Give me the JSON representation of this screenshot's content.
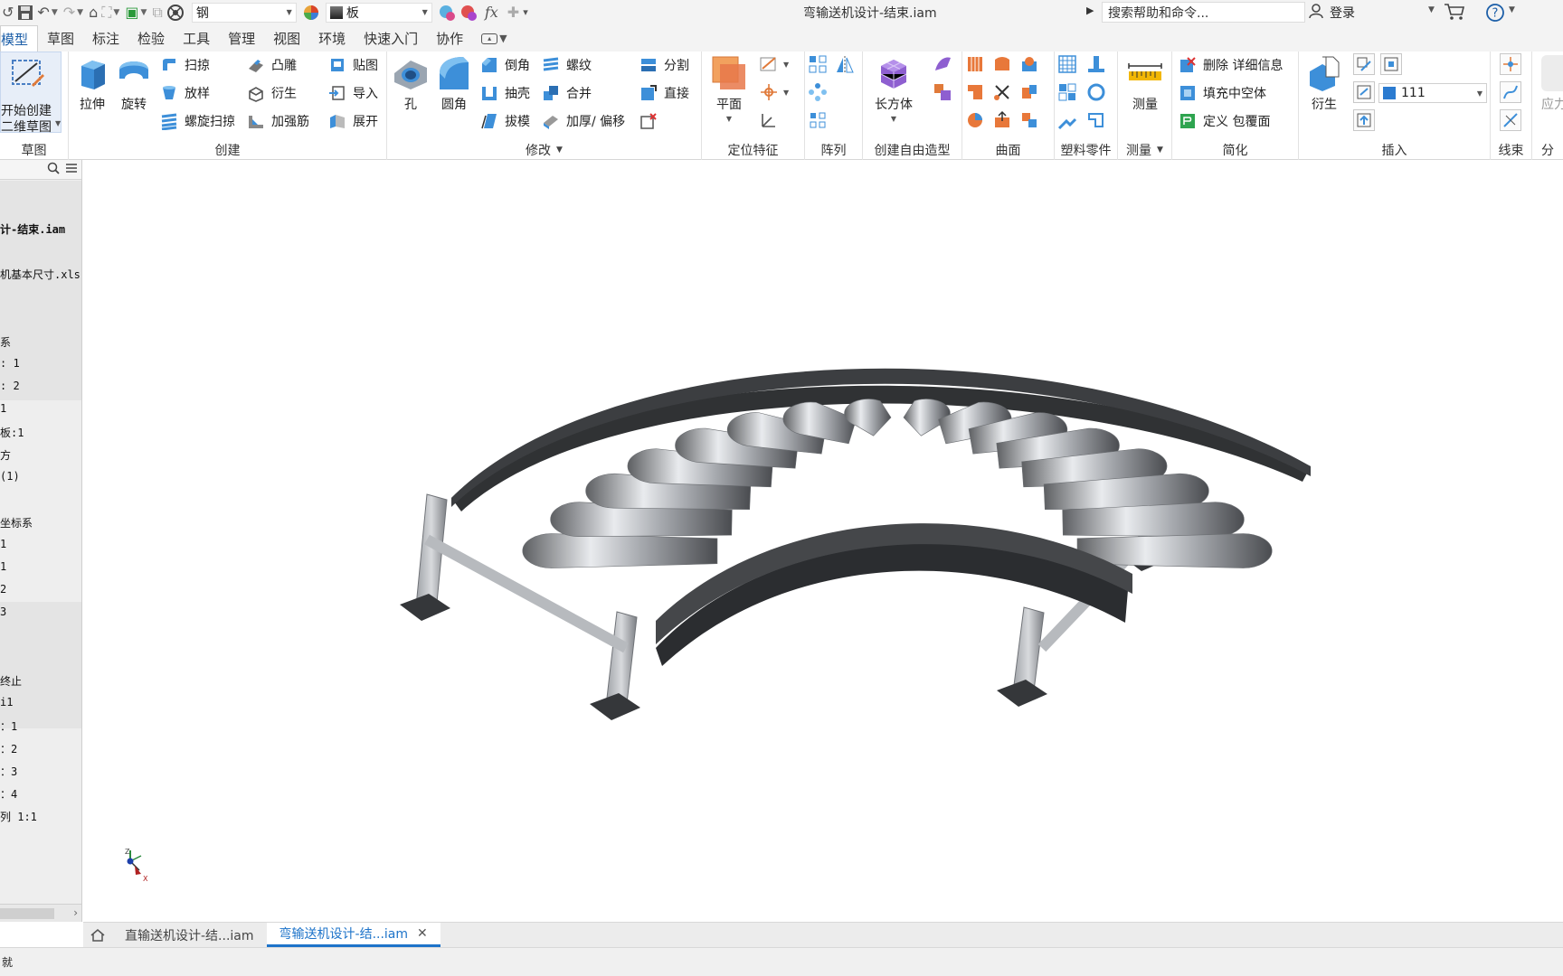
{
  "quick_access": {
    "material": "钢",
    "appearance": "板",
    "fx": "fx"
  },
  "title": "弯输送机设计-结束.iam",
  "search": {
    "placeholder": "搜索帮助和命令..."
  },
  "user": {
    "login": "登录"
  },
  "tabs": [
    "模型",
    "草图",
    "标注",
    "检验",
    "工具",
    "管理",
    "视图",
    "环境",
    "快速入门",
    "协作"
  ],
  "ribbon": {
    "sketch": {
      "title": "草图",
      "start_sketch_line1": "开始创建",
      "start_sketch_line2": "二维草图"
    },
    "create": {
      "title": "创建",
      "extrude": "拉伸",
      "revolve": "旋转",
      "sweep": "扫掠",
      "loft": "放样",
      "coil": "螺旋扫掠",
      "emboss": "凸雕",
      "derive": "衍生",
      "rib": "加强筋",
      "decal": "贴图",
      "import": "导入",
      "unfold": "展开"
    },
    "modify": {
      "title": "修改",
      "hole": "孔",
      "fillet": "圆角",
      "chamfer": "倒角",
      "shell": "抽壳",
      "draft": "拔模",
      "thread": "螺纹",
      "combine": "合并",
      "thicken": "加厚/ 偏移",
      "split": "分割",
      "direct": "直接"
    },
    "work_features": {
      "title": "定位特征",
      "plane": "平面"
    },
    "pattern": {
      "title": "阵列"
    },
    "freeform": {
      "title": "创建自由造型",
      "box": "长方体"
    },
    "surface": {
      "title": "曲面"
    },
    "plastic": {
      "title": "塑料零件"
    },
    "measure": {
      "title": "测量",
      "measure": "测量"
    },
    "simplify": {
      "title": "简化",
      "remove_details": "删除 详细信息",
      "fill_voids": "填充中空体",
      "define_envelopes": "定义 包覆面"
    },
    "insert": {
      "title": "插入",
      "derive": "衍生",
      "value": "111"
    },
    "harness": {
      "title": "线束"
    },
    "stress": {
      "title": "分",
      "label": "应力"
    }
  },
  "browser": {
    "items": [
      "计-结束.iam",
      "机基本尺寸.xls",
      "系",
      ": 1",
      ": 2",
      "1",
      "板:1",
      "方",
      "(1)",
      "坐标系",
      "1",
      "1",
      "2",
      "3",
      "终止",
      "i1",
      "：1",
      "：2",
      "：3",
      "：4",
      "列 1:1"
    ]
  },
  "triad": {
    "z": "Z",
    "x": "X"
  },
  "document_tabs": [
    {
      "label": "直输送机设计-结...iam"
    },
    {
      "label": "弯输送机设计-结...iam",
      "close": "✕"
    }
  ],
  "status": {
    "text": "就"
  },
  "colors": {
    "accent": "#1d73c9",
    "ribbon_bg": "#ffffff",
    "chrome_bg": "#f3f3f3"
  }
}
